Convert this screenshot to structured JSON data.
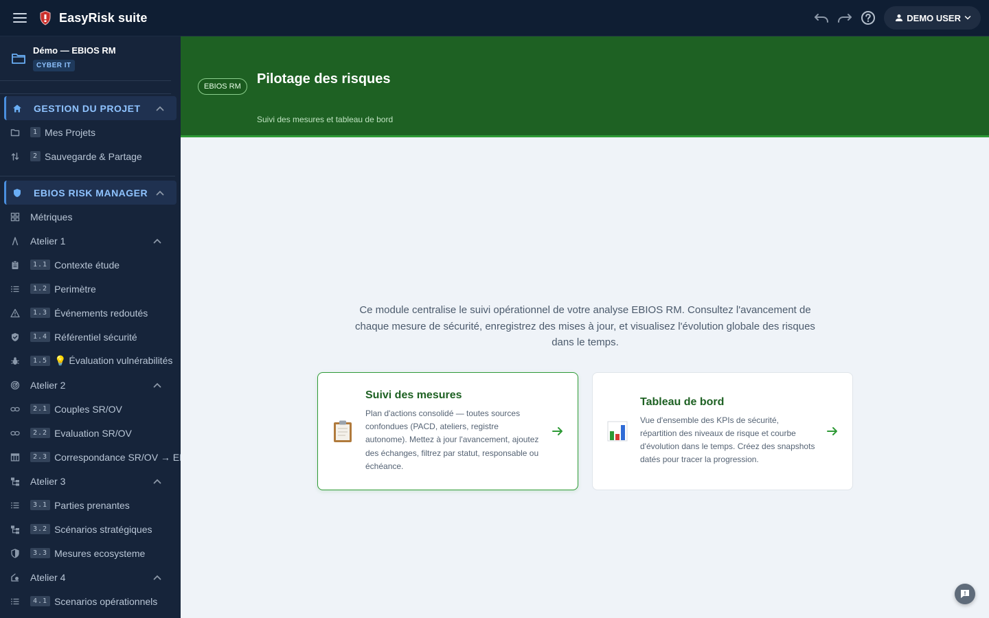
{
  "app": {
    "title": "EasyRisk suite"
  },
  "user": {
    "label": "DEMO USER"
  },
  "project": {
    "name": "Démo — EBIOS RM",
    "tag": "CYBER IT"
  },
  "sidebar": {
    "section_project": {
      "label": "GESTION DU PROJET",
      "items": [
        {
          "num": "1",
          "label": "Mes Projets"
        },
        {
          "num": "2",
          "label": "Sauvegarde & Partage"
        }
      ]
    },
    "section_ebios": {
      "label": "EBIOS RISK MANAGER",
      "metrics": "Métriques",
      "atelier1": {
        "label": "Atelier 1",
        "items": [
          {
            "num": "1.1",
            "label": "Contexte étude"
          },
          {
            "num": "1.2",
            "label": "Perimètre"
          },
          {
            "num": "1.3",
            "label": "Événements redoutés"
          },
          {
            "num": "1.4",
            "label": "Référentiel sécurité"
          },
          {
            "num": "1.5",
            "label": "💡 Évaluation vulnérabilités"
          }
        ]
      },
      "atelier2": {
        "label": "Atelier 2",
        "items": [
          {
            "num": "2.1",
            "label": "Couples SR/OV"
          },
          {
            "num": "2.2",
            "label": "Evaluation SR/OV"
          },
          {
            "num": "2.3",
            "label": "Correspondance SR/OV → ER"
          }
        ]
      },
      "atelier3": {
        "label": "Atelier 3",
        "items": [
          {
            "num": "3.1",
            "label": "Parties prenantes"
          },
          {
            "num": "3.2",
            "label": "Scénarios stratégiques"
          },
          {
            "num": "3.3",
            "label": "Mesures ecosysteme"
          }
        ]
      },
      "atelier4": {
        "label": "Atelier 4",
        "items": [
          {
            "num": "4.1",
            "label": "Scenarios opérationnels"
          }
        ]
      }
    }
  },
  "hero": {
    "badge": "EBIOS RM",
    "title": "Pilotage des risques",
    "subtitle": "Suivi des mesures et tableau de bord"
  },
  "intro": "Ce module centralise le suivi opérationnel de votre analyse EBIOS RM. Consultez l'avancement de chaque mesure de sécurité, enregistrez des mises à jour, et visualisez l'évolution globale des risques dans le temps.",
  "cards": [
    {
      "icon": "clipboard-icon",
      "title": "Suivi des mesures",
      "description": "Plan d'actions consolidé — toutes sources confondues (PACD, ateliers, registre autonome). Mettez à jour l'avancement, ajoutez des échanges, filtrez par statut, responsable ou échéance."
    },
    {
      "icon": "bar-chart-icon",
      "title": "Tableau de bord",
      "description": "Vue d'ensemble des KPIs de sécurité, répartition des niveaux de risque et courbe d'évolution dans le temps. Créez des snapshots datés pour tracer la progression."
    }
  ],
  "colors": {
    "accent": "#1e6123",
    "sidebar": "#16243a",
    "topbar": "#0f1e33",
    "link": "#8fc3ff"
  }
}
